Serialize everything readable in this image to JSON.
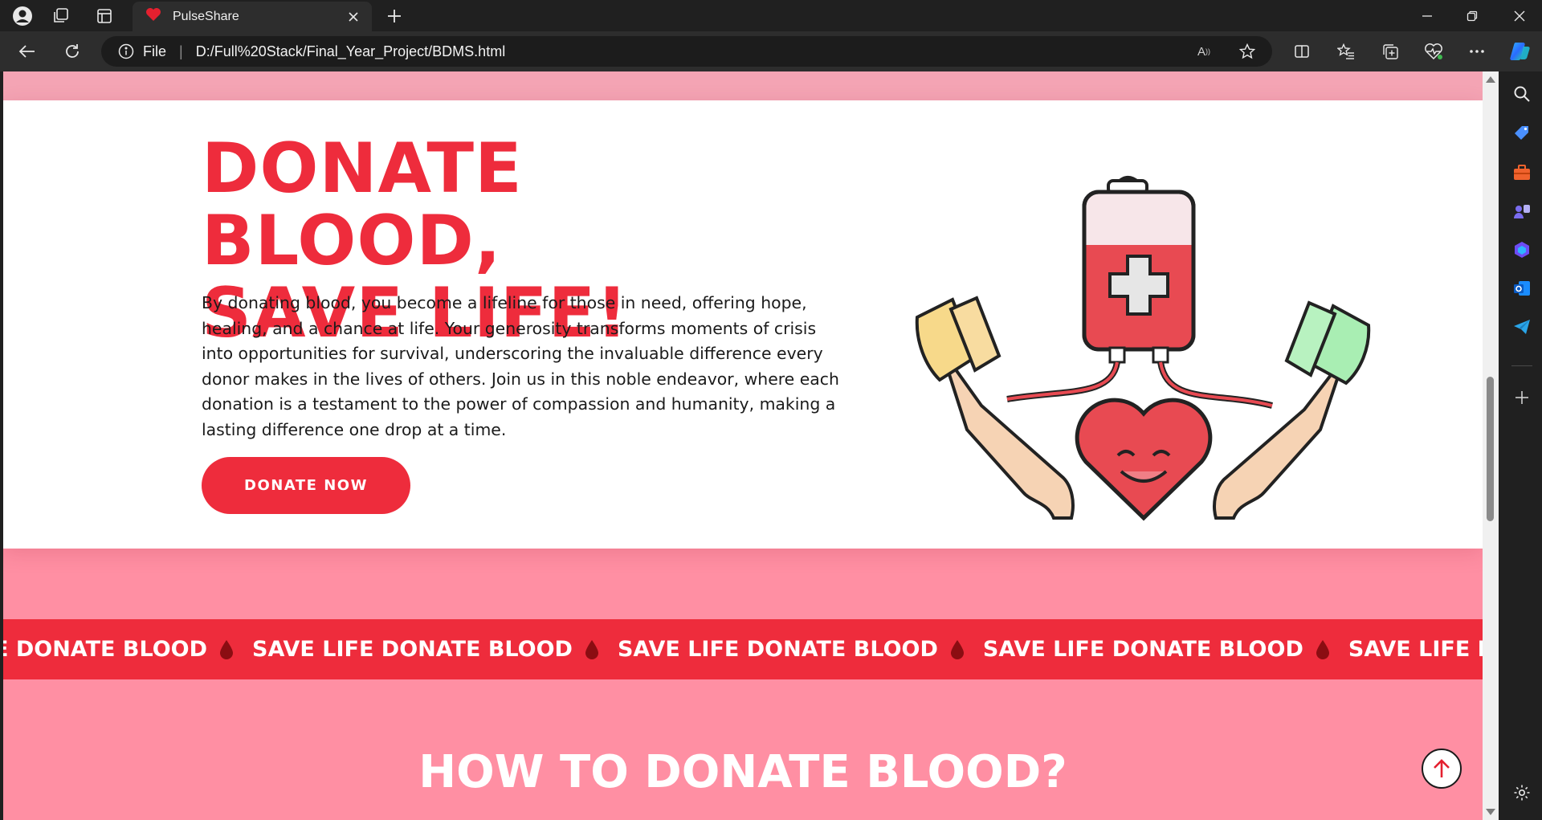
{
  "browser": {
    "tab_title": "PulseShare",
    "address_scheme": "File",
    "address_url": "D:/Full%20Stack/Final_Year_Project/BDMS.html",
    "read_aloud_label": "A"
  },
  "hero": {
    "title_line1": "DONATE BLOOD,",
    "title_line2": "SAVE LIFE!",
    "description": "By donating blood, you become a lifeline for those in need, offering hope, healing, and a chance at life. Your generosity transforms moments of crisis into opportunities for survival, underscoring the invaluable difference every donor makes in the lives of others. Join us in this noble endeavor, where each donation is a testament to the power of compassion and humanity, making a lasting difference one drop at a time.",
    "cta_label": "DONATE NOW"
  },
  "ticker": {
    "items": [
      "E DONATE BLOOD",
      "SAVE LIFE DONATE BLOOD",
      "SAVE LIFE DONATE BLOOD",
      "SAVE LIFE DONATE BLOOD",
      "SAVE LIFE DONATE BLOOD",
      "S"
    ]
  },
  "section": {
    "title": "HOW TO DONATE BLOOD?"
  },
  "colors": {
    "brand_red": "#ee2c3c",
    "page_pink": "#ff8fa3",
    "top_strip_pink": "#f4a4b4"
  }
}
